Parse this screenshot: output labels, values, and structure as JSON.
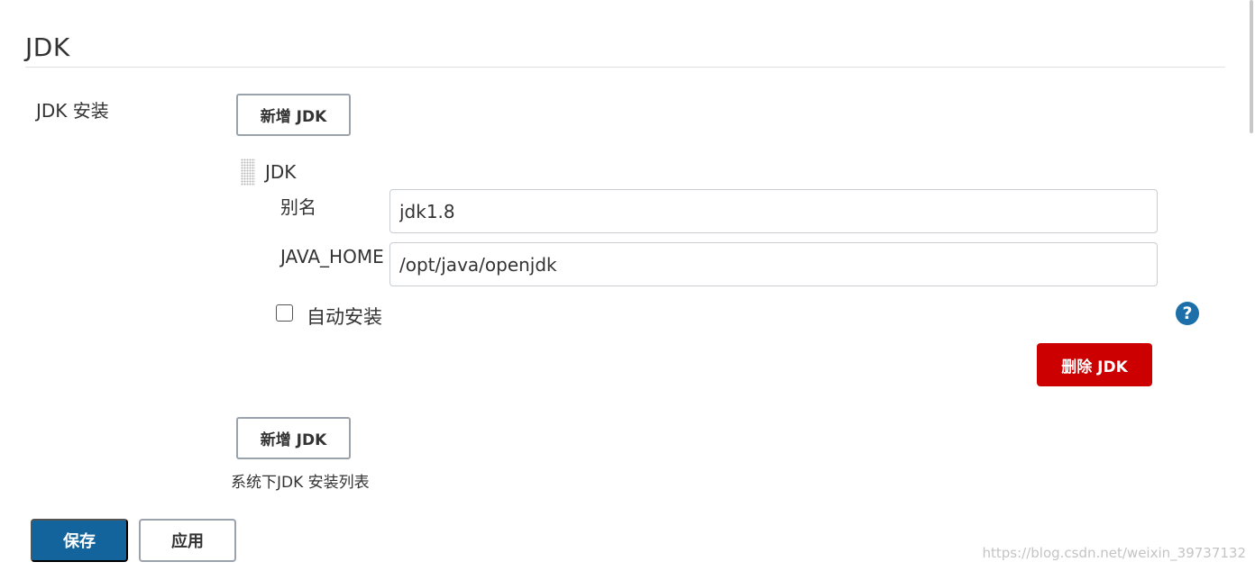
{
  "section": {
    "title": "JDK"
  },
  "jdk_installations": {
    "label": "JDK 安装",
    "add_button_label": "新增 JDK",
    "description": "系统下JDK 安装列表"
  },
  "jdk_block": {
    "title": "JDK",
    "alias_label": "别名",
    "alias_value": "jdk1.8",
    "java_home_label": "JAVA_HOME",
    "java_home_value": "/opt/java/openjdk",
    "auto_install_label": "自动安装",
    "auto_install_checked": false,
    "help_icon_glyph": "?",
    "delete_button_label": "删除 JDK"
  },
  "footer": {
    "save_label": "保存",
    "apply_label": "应用"
  },
  "watermark": "https://blog.csdn.net/weixin_39737132",
  "colors": {
    "primary": "#13649c",
    "danger": "#cc0000",
    "help": "#1c6fa8"
  },
  "icons": {
    "help": "help-icon",
    "drag": "drag-handle-icon"
  }
}
